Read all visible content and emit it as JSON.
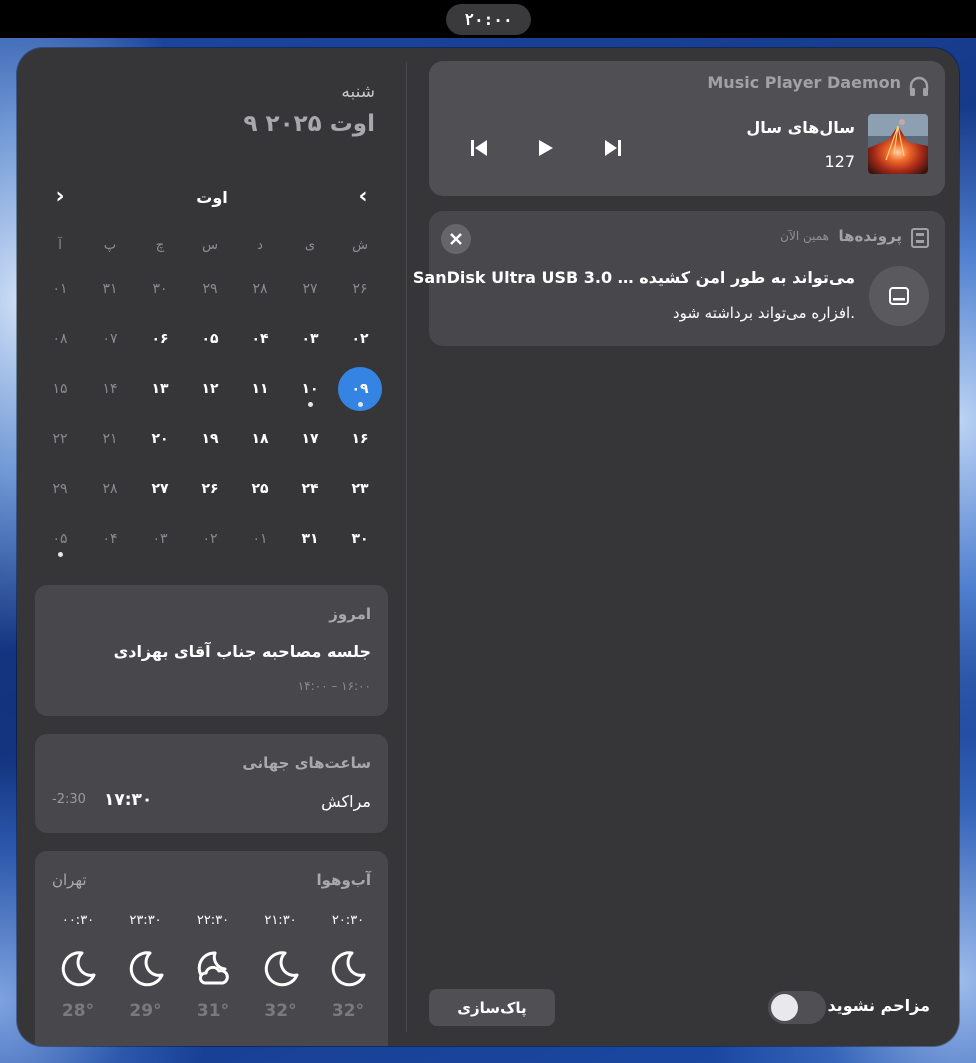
{
  "topbar": {
    "clock": "۲۰:۰۰"
  },
  "calendar": {
    "weekday": "شنبه",
    "full_date": "۹ اوت ۲۰۲۵",
    "month": "اوت",
    "day_headers": [
      "ش",
      "ی",
      "د",
      "س",
      "چ",
      "پ",
      "آ"
    ],
    "weeks": [
      [
        {
          "n": "۲۶",
          "dim": true
        },
        {
          "n": "۲۷",
          "dim": true
        },
        {
          "n": "۲۸",
          "dim": true
        },
        {
          "n": "۲۹",
          "dim": true
        },
        {
          "n": "۳۰",
          "dim": true
        },
        {
          "n": "۳۱",
          "dim": true
        },
        {
          "n": "۰۱",
          "dim": true
        }
      ],
      [
        {
          "n": "۰۲"
        },
        {
          "n": "۰۳"
        },
        {
          "n": "۰۴"
        },
        {
          "n": "۰۵"
        },
        {
          "n": "۰۶"
        },
        {
          "n": "۰۷",
          "dim": true
        },
        {
          "n": "۰۸",
          "dim": true
        }
      ],
      [
        {
          "n": "۰۹",
          "today": true,
          "event": true
        },
        {
          "n": "۱۰",
          "event": true
        },
        {
          "n": "۱۱"
        },
        {
          "n": "۱۲"
        },
        {
          "n": "۱۳"
        },
        {
          "n": "۱۴",
          "dim": true
        },
        {
          "n": "۱۵",
          "dim": true
        }
      ],
      [
        {
          "n": "۱۶"
        },
        {
          "n": "۱۷"
        },
        {
          "n": "۱۸"
        },
        {
          "n": "۱۹"
        },
        {
          "n": "۲۰"
        },
        {
          "n": "۲۱",
          "dim": true
        },
        {
          "n": "۲۲",
          "dim": true
        }
      ],
      [
        {
          "n": "۲۳"
        },
        {
          "n": "۲۴"
        },
        {
          "n": "۲۵"
        },
        {
          "n": "۲۶"
        },
        {
          "n": "۲۷"
        },
        {
          "n": "۲۸",
          "dim": true
        },
        {
          "n": "۲۹",
          "dim": true
        }
      ],
      [
        {
          "n": "۳۰"
        },
        {
          "n": "۳۱"
        },
        {
          "n": "۰۱",
          "dim": true
        },
        {
          "n": "۰۲",
          "dim": true
        },
        {
          "n": "۰۳",
          "dim": true
        },
        {
          "n": "۰۴",
          "dim": true
        },
        {
          "n": "۰۵",
          "dim": true,
          "event": true
        }
      ]
    ]
  },
  "today": {
    "title": "امروز",
    "event_title": "جلسه مصاحبه جناب آقای بهزادی",
    "event_time": "۱۴:۰۰ – ۱۶:۰۰"
  },
  "world_clocks": {
    "title": "ساعت‌های جهانی",
    "city": "مراکش",
    "time": "۱۷:۳۰",
    "offset": "-2:30"
  },
  "weather": {
    "title": "آب‌وهوا",
    "location": "تهران",
    "forecast": [
      {
        "time": "۲۰:۳۰",
        "icon": "moon-icon",
        "temp": "32°"
      },
      {
        "time": "۲۱:۳۰",
        "icon": "moon-icon",
        "temp": "32°"
      },
      {
        "time": "۲۲:۳۰",
        "icon": "moon-cloud-icon",
        "temp": "31°"
      },
      {
        "time": "۲۳:۳۰",
        "icon": "moon-icon",
        "temp": "29°"
      },
      {
        "time": "۰۰:۳۰",
        "icon": "moon-icon",
        "temp": "28°"
      }
    ]
  },
  "media": {
    "app": "Music Player Daemon",
    "track_title": "سال‌های سال",
    "track_artist": "127",
    "icon": "headphones-icon"
  },
  "notification": {
    "app": "پرونده‌ها",
    "time": "همین الآن",
    "title": "SanDisk Ultra USB 3.0 … می‌تواند به طور امن کشیده",
    "body": "افزاره می‌تواند برداشته شود.",
    "icon": "drive-icon"
  },
  "footer": {
    "clear_label": "پاک‌سازی",
    "dnd_label": "مزاحم نشوید",
    "dnd_enabled": false
  },
  "colors": {
    "accent": "#3584e4",
    "panel": "#363639",
    "card": "#48484c"
  }
}
